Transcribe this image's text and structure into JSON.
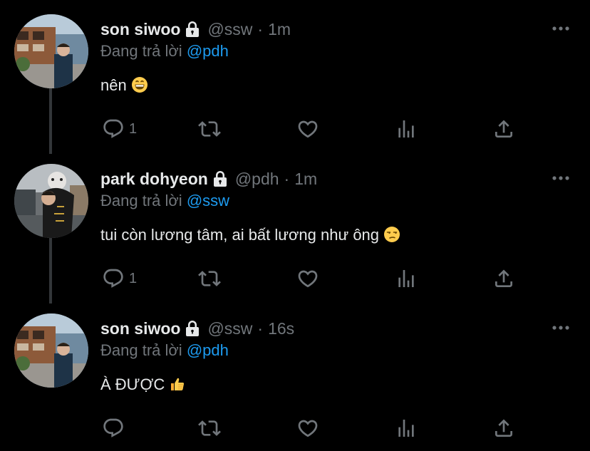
{
  "colors": {
    "background": "#000000",
    "text": "#e7e9ea",
    "muted": "#71767b",
    "link": "#1d9bf0",
    "thread_line": "#333639"
  },
  "tweets": [
    {
      "name": "son siwoo",
      "handle": "@ssw",
      "separator": "·",
      "time": "1m",
      "reply_prefix": "Đang trả lời",
      "reply_to": "@pdh",
      "text": "nên",
      "emoji": "grinning-face-emoji",
      "reply_count": "1",
      "avatar": "avatar-street-photo",
      "protected": true
    },
    {
      "name": "park dohyeon",
      "handle": "@pdh",
      "separator": "·",
      "time": "1m",
      "reply_prefix": "Đang trả lời",
      "reply_to": "@ssw",
      "text": "tui còn lương tâm, ai bất lương như ông",
      "emoji": "unamused-face-emoji",
      "reply_count": "1",
      "avatar": "avatar-piggyback-photo",
      "protected": true
    },
    {
      "name": "son siwoo",
      "handle": "@ssw",
      "separator": "·",
      "time": "16s",
      "reply_prefix": "Đang trả lời",
      "reply_to": "@pdh",
      "text": "À ĐƯỢC",
      "emoji": "thumbs-up-emoji",
      "reply_count": "",
      "avatar": "avatar-street-photo",
      "protected": true
    }
  ],
  "icons": {
    "reply": "reply-icon",
    "retweet": "retweet-icon",
    "like": "heart-icon",
    "analytics": "analytics-icon",
    "share": "share-icon",
    "more": "more-options-icon",
    "lock": "lock-icon"
  }
}
